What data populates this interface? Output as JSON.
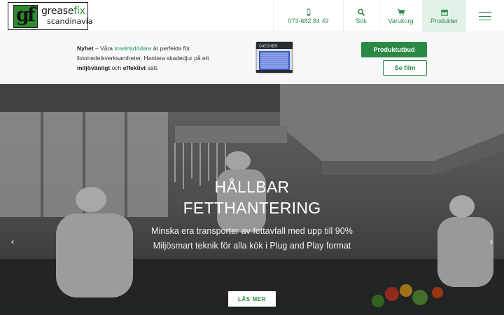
{
  "header": {
    "logo": {
      "mark": "gf",
      "word_grease": "grease",
      "word_fix": "fix",
      "word_region": "scandinavia"
    },
    "nav": {
      "phone": {
        "label": "073-682 84 49",
        "icon": "phone-icon"
      },
      "search": {
        "label": "Sök",
        "icon": "search-icon"
      },
      "cart": {
        "label": "Varukorg",
        "icon": "cart-icon"
      },
      "products": {
        "label": "Produkter",
        "icon": "products-box-icon"
      },
      "menu": {
        "icon": "hamburger-menu-icon"
      }
    }
  },
  "promo": {
    "lead": "Nyhet",
    "dash": " – Våra ",
    "link": "insektsdödare",
    "text1": " är perfekta för livsmedelsverksamheter. Hantera skadedjur på ett ",
    "bold1": "miljövänligt",
    "and": " och ",
    "bold2": "effektivt",
    "text2": " sätt.",
    "product_label": "CATCHER",
    "primary_button": "Produktutbud",
    "secondary_button": "Se film"
  },
  "hero": {
    "title_line1": "HÅLLBAR",
    "title_line2": "FETTHANTERING",
    "sub_line1": "Minska era transporter av fettavfall med upp till 90%",
    "sub_line2": "Miljösmart teknik för alla kök i Plug and Play format",
    "button": "LÄS MER",
    "prev_arrow": "‹",
    "next_arrow": "›"
  },
  "colors": {
    "brand_green": "#2a8a44",
    "nav_active_bg": "#e3f1e7",
    "promo_bg": "#f5f7f8",
    "link_green": "#2a9a55"
  }
}
